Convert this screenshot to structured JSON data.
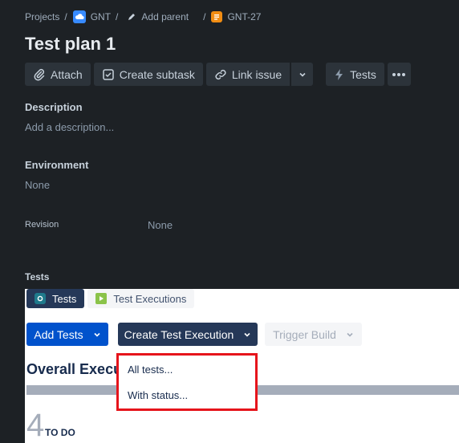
{
  "breadcrumb": {
    "projects": "Projects",
    "project": "GNT",
    "add_parent": "Add parent",
    "issue_key": "GNT-27",
    "separator": "/"
  },
  "title": "Test plan 1",
  "toolbar": {
    "attach": "Attach",
    "create_subtask": "Create subtask",
    "link_issue": "Link issue",
    "tests": "Tests"
  },
  "description": {
    "label": "Description",
    "placeholder": "Add a description..."
  },
  "environment": {
    "label": "Environment",
    "value": "None"
  },
  "revision": {
    "label": "Revision",
    "value": "None"
  },
  "tests_section": {
    "label": "Tests",
    "tabs": [
      "Tests",
      "Test Executions"
    ],
    "add_tests": "Add Tests",
    "create_test_execution": "Create Test Execution",
    "trigger_build": "Trigger Build",
    "overall_heading": "Overall Execu",
    "todo_count": "4",
    "todo_label": "TO DO"
  },
  "dropdown": {
    "items": [
      "All tests...",
      "With status..."
    ]
  },
  "colors": {
    "background": "#1d2125",
    "primary_blue": "#0052cc",
    "navy": "#253858",
    "highlight_red": "#e6141b"
  }
}
